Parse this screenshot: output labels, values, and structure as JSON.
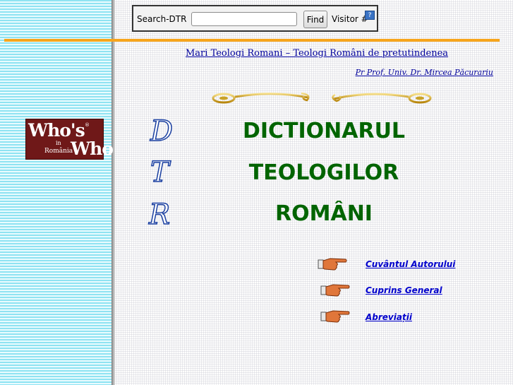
{
  "search": {
    "label": "Search-DTR",
    "value": "",
    "find_label": "Find",
    "visitor_label": "Visitor #"
  },
  "logo": {
    "main": "Who's",
    "registered": "®",
    "in": "in",
    "country": "România",
    "who": "Who"
  },
  "header": {
    "link": "Mari Teologi Romani – Teologi Români de pretutindenea",
    "author": "Pr Prof. Univ. Dr. Mircea Păcurariu"
  },
  "letters": [
    "D",
    "T",
    "R"
  ],
  "title": {
    "line1": "DICTIONARUL",
    "line2": "TEOLOGILOR",
    "line3": "ROMÂNI"
  },
  "nav": {
    "items": [
      {
        "label": "Cuvântul Autorului"
      },
      {
        "label": "Cuprins General"
      },
      {
        "label": "Abreviații"
      }
    ]
  },
  "icons": {
    "visitor_counter": "counter-icon",
    "nav_pointer": "pointing-hand-icon",
    "ornament": "scroll-ornament"
  },
  "colors": {
    "title_green": "#006400",
    "link_blue": "#00009c",
    "orange_rule": "#f7a51c",
    "logo_red": "#6f1818"
  }
}
